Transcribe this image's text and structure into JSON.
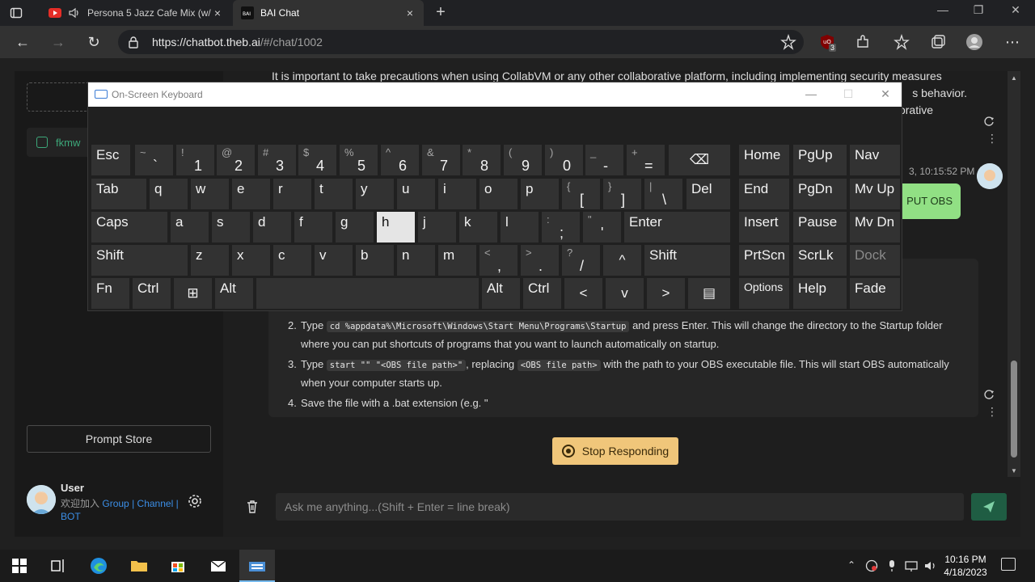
{
  "browser": {
    "tabs": [
      {
        "title": "Persona 5 Jazz Cafe Mix (w/",
        "close": "×"
      },
      {
        "title": "BAI Chat",
        "close": "×"
      }
    ],
    "new_tab": "+",
    "url_host": "https://chatbot.theb.ai",
    "url_path": "/#/chat/1002",
    "extension_badge": "3"
  },
  "sidebar": {
    "chat_item_label": "fkmw",
    "prompt_store": "Prompt Store",
    "user_name": "User",
    "user_links_prefix": "欢迎加入",
    "link_group": "Group",
    "link_channel": "Channel",
    "link_bot": "BOT",
    "sep": "|"
  },
  "chat": {
    "top_message": "It is important to take precautions when using CollabVM or any other collaborative platform, including implementing security measures",
    "top_message_tail1": "s behavior.",
    "top_message_tail2": "aborative",
    "timestamp": "3, 10:15:52 PM",
    "user_bubble": "PUT OBS",
    "answer_steps": [
      {
        "num": "2.",
        "pre": "Type ",
        "code": "cd %appdata%\\Microsoft\\Windows\\Start Menu\\Programs\\Startup",
        "post": " and press Enter. This will change the directory to the Startup folder where you can put shortcuts of programs that you want to launch automatically on startup."
      },
      {
        "num": "3.",
        "pre": "Type ",
        "code": "start \"\" \"<OBS file path>\"",
        "mid": ", replacing ",
        "code2": "<OBS file path>",
        "post": " with the path to your OBS executable file. This will start OBS automatically when your computer starts up."
      },
      {
        "num": "4.",
        "pre": "Save the file with a .bat extension (e.g. \"",
        "post": ""
      }
    ],
    "stop_button": "Stop Responding",
    "input_placeholder": "Ask me anything...(Shift + Enter = line break)"
  },
  "osk": {
    "title": "On-Screen Keyboard",
    "row1": [
      {
        "label": "Esc"
      },
      {
        "up": "~",
        "lo": "`"
      },
      {
        "up": "!",
        "lo": "1"
      },
      {
        "up": "@",
        "lo": "2"
      },
      {
        "up": "#",
        "lo": "3"
      },
      {
        "up": "$",
        "lo": "4"
      },
      {
        "up": "%",
        "lo": "5"
      },
      {
        "up": "^",
        "lo": "6"
      },
      {
        "up": "&",
        "lo": "7"
      },
      {
        "up": "*",
        "lo": "8"
      },
      {
        "up": "(",
        "lo": "9"
      },
      {
        "up": ")",
        "lo": "0"
      },
      {
        "up": "_",
        "lo": "-"
      },
      {
        "up": "+",
        "lo": "="
      },
      {
        "label": "⌫"
      }
    ],
    "row2": [
      {
        "label": "Tab"
      },
      {
        "label": "q"
      },
      {
        "label": "w"
      },
      {
        "label": "e"
      },
      {
        "label": "r"
      },
      {
        "label": "t"
      },
      {
        "label": "y"
      },
      {
        "label": "u"
      },
      {
        "label": "i"
      },
      {
        "label": "o"
      },
      {
        "label": "p"
      },
      {
        "up": "{",
        "lo": "["
      },
      {
        "up": "}",
        "lo": "]"
      },
      {
        "up": "|",
        "lo": "\\"
      },
      {
        "label": "Del"
      }
    ],
    "row3": [
      {
        "label": "Caps"
      },
      {
        "label": "a"
      },
      {
        "label": "s"
      },
      {
        "label": "d"
      },
      {
        "label": "f"
      },
      {
        "label": "g"
      },
      {
        "label": "h"
      },
      {
        "label": "j"
      },
      {
        "label": "k"
      },
      {
        "label": "l"
      },
      {
        "up": ":",
        "lo": ";"
      },
      {
        "up": "\"",
        "lo": "'"
      },
      {
        "label": "Enter"
      }
    ],
    "row4": [
      {
        "label": "Shift"
      },
      {
        "label": "z"
      },
      {
        "label": "x"
      },
      {
        "label": "c"
      },
      {
        "label": "v"
      },
      {
        "label": "b"
      },
      {
        "label": "n"
      },
      {
        "label": "m"
      },
      {
        "up": "<",
        "lo": ","
      },
      {
        "up": ">",
        "lo": "."
      },
      {
        "up": "?",
        "lo": "/"
      },
      {
        "label": "^"
      },
      {
        "label": "Shift"
      }
    ],
    "row5": [
      {
        "label": "Fn"
      },
      {
        "label": "Ctrl"
      },
      {
        "label": "⊞"
      },
      {
        "label": "Alt"
      },
      {
        "label": ""
      },
      {
        "label": "Alt"
      },
      {
        "label": "Ctrl"
      },
      {
        "label": "<"
      },
      {
        "label": "v"
      },
      {
        "label": ">"
      },
      {
        "label": "▤"
      }
    ],
    "nav": [
      [
        "Home",
        "PgUp",
        "Nav"
      ],
      [
        "End",
        "PgDn",
        "Mv Up"
      ],
      [
        "Insert",
        "Pause",
        "Mv Dn"
      ],
      [
        "PrtScn",
        "ScrLk",
        "Dock"
      ],
      [
        "Options",
        "Help",
        "Fade"
      ]
    ],
    "active_key": "h"
  },
  "taskbar": {
    "time": "10:16 PM",
    "date": "4/18/2023"
  },
  "colors": {
    "accent_green": "#3da87a",
    "stop_button": "#f0c67a",
    "user_bubble": "#91e084",
    "link_blue": "#3b8ee6"
  }
}
